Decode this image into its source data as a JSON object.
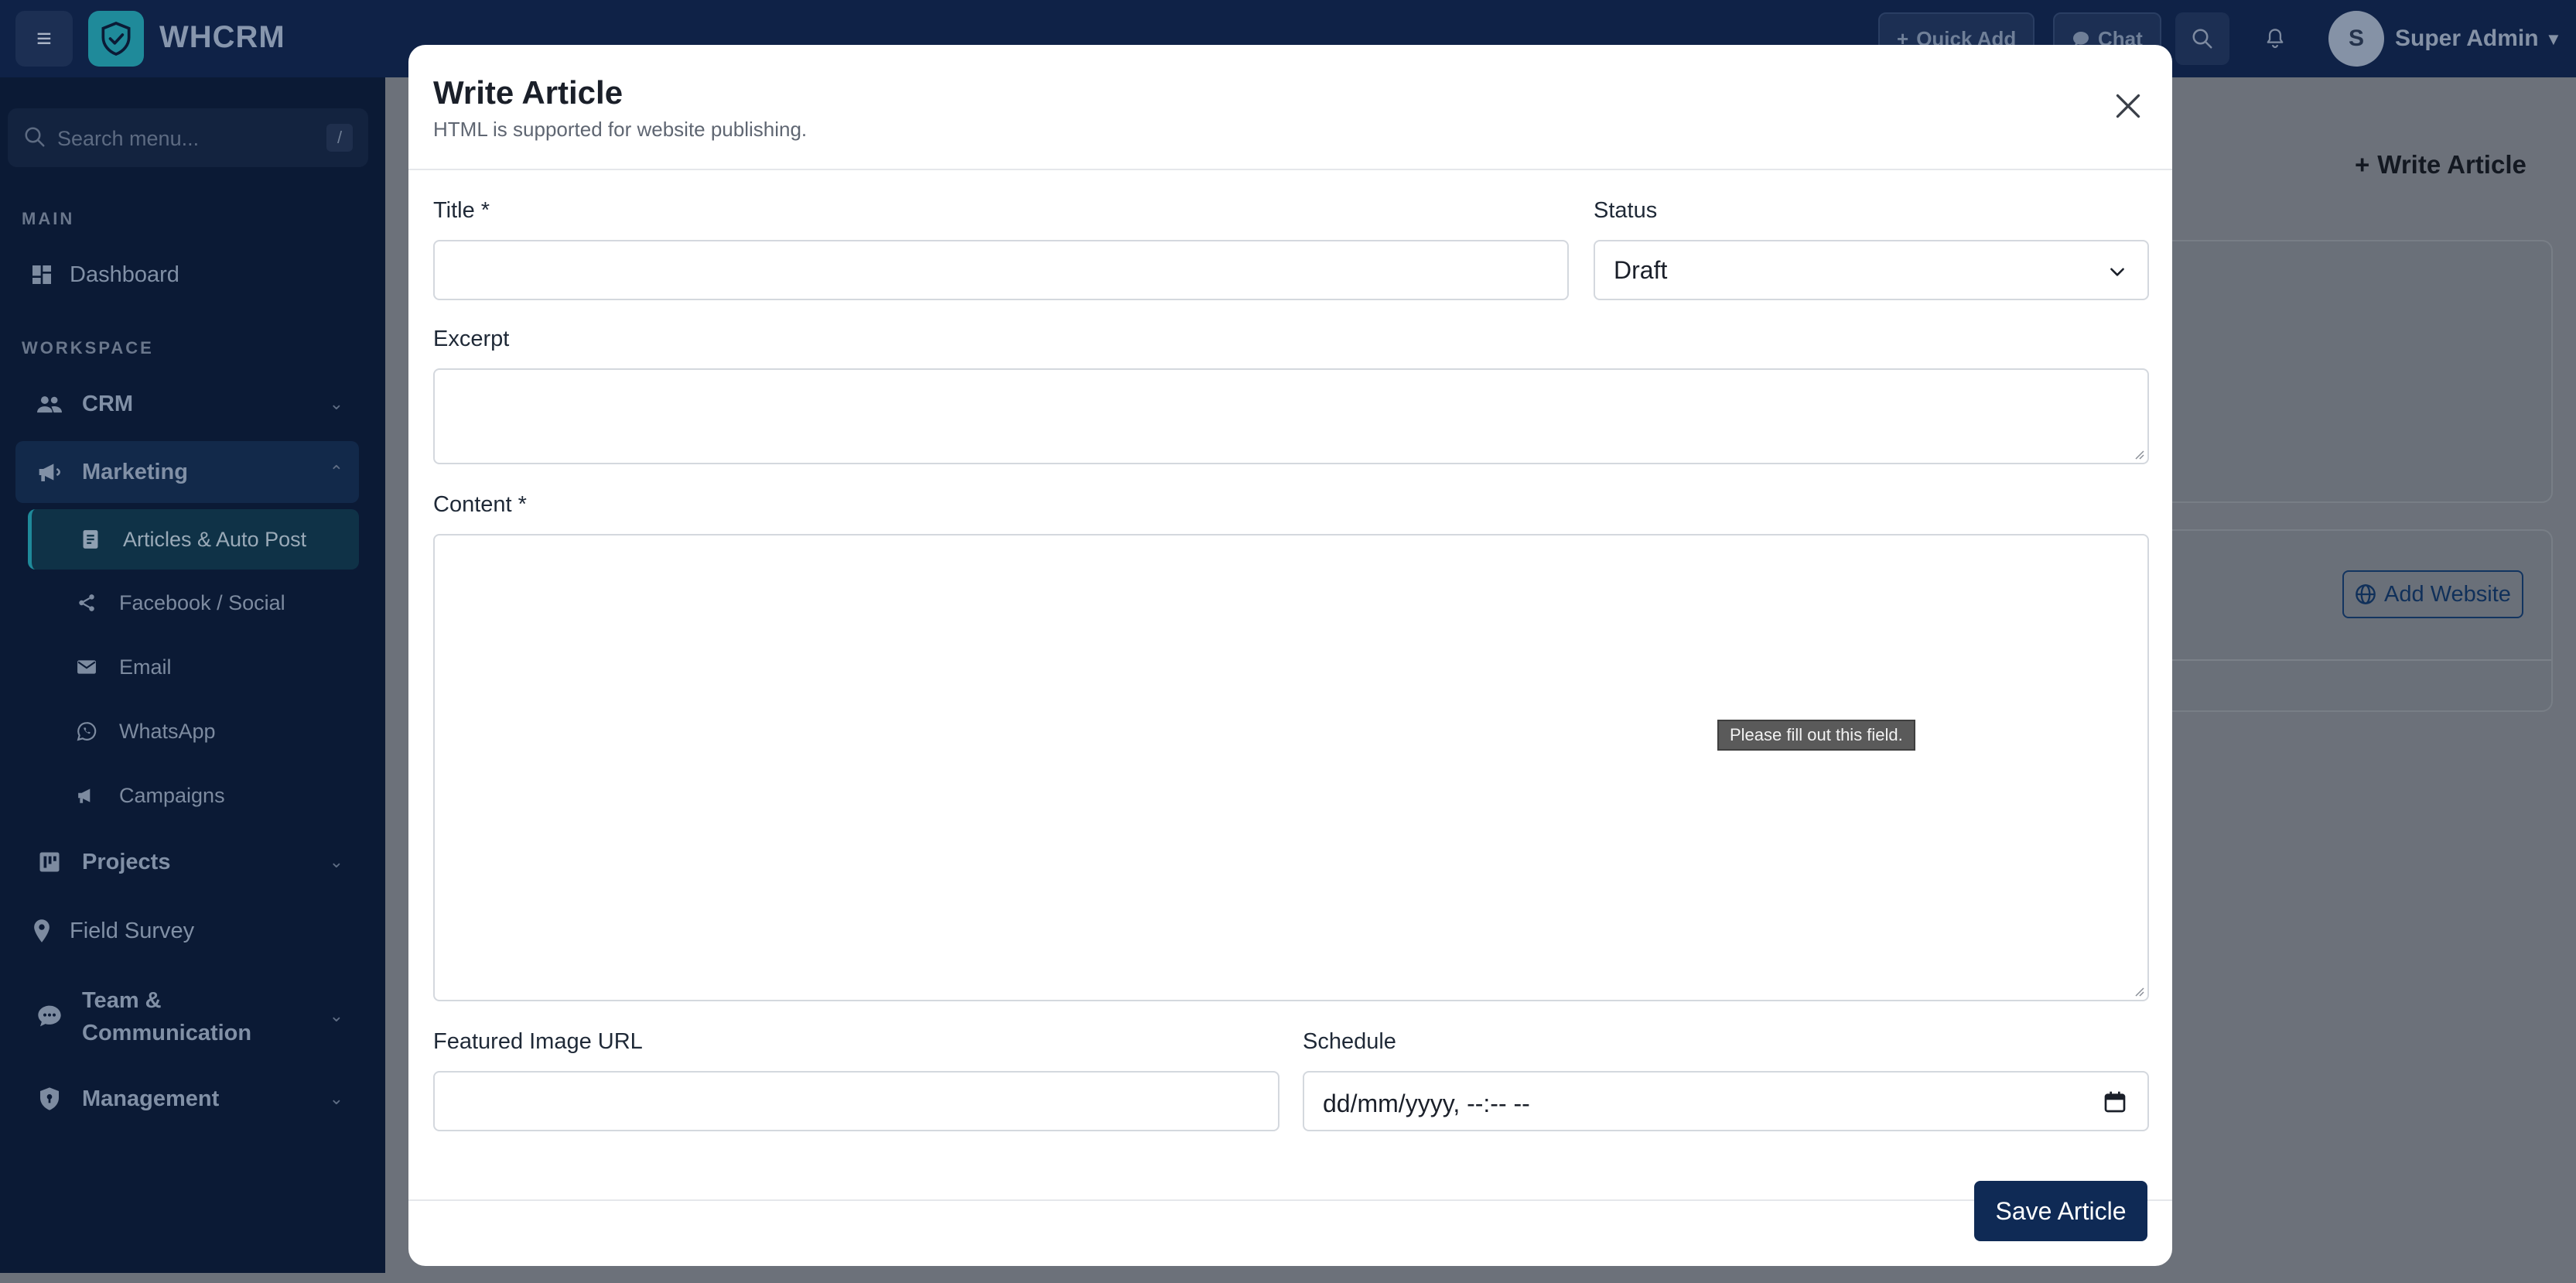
{
  "app": {
    "brand": "WHCRM",
    "user_initial": "S",
    "user_name": "Super Admin"
  },
  "topbar": {
    "quick_add_label": "Quick Add",
    "chat_label": "Chat"
  },
  "sidebar": {
    "search_placeholder": "Search menu...",
    "search_shortcut": "/",
    "section_main": "MAIN",
    "section_workspace": "WORKSPACE",
    "items": {
      "dashboard": "Dashboard",
      "crm": "CRM",
      "marketing": "Marketing",
      "projects": "Projects",
      "field_survey": "Field Survey",
      "team_line1": "Team &",
      "team_line2": "Communication",
      "management": "Management"
    },
    "marketing_sub": {
      "articles": "Articles & Auto Post",
      "facebook": "Facebook / Social",
      "email": "Email",
      "whatsapp": "WhatsApp",
      "campaigns": "Campaigns"
    }
  },
  "background": {
    "write_article_label": "Write Article",
    "add_website_label": "Add Website"
  },
  "modal": {
    "title": "Write Article",
    "subtitle": "HTML is supported for website publishing.",
    "title_label": "Title *",
    "title_value": "",
    "status_label": "Status",
    "status_value": "Draft",
    "excerpt_label": "Excerpt",
    "excerpt_value": "",
    "content_label": "Content *",
    "content_value": "",
    "featured_image_label": "Featured Image URL",
    "featured_image_value": "",
    "schedule_label": "Schedule",
    "schedule_placeholder": "dd/mm/yyyy, --:-- --",
    "validation_tooltip": "Please fill out this field.",
    "save_label": "Save Article"
  },
  "colors": {
    "topbar": "#0f2247",
    "sidebar": "#0b1a35",
    "accent_teal": "#1f8a9a",
    "primary_button": "#0f2a55"
  },
  "icons": [
    "menu-icon",
    "shield-check-icon",
    "plus-icon",
    "chat-icon",
    "search-icon",
    "bell-icon",
    "dashboard-icon",
    "users-icon",
    "megaphone-icon",
    "article-icon",
    "share-icon",
    "mail-icon",
    "whatsapp-icon",
    "projects-icon",
    "map-pin-icon",
    "chat-bubble-icon",
    "shield-icon",
    "close-icon",
    "chevron-down-icon",
    "calendar-icon",
    "globe-icon"
  ]
}
